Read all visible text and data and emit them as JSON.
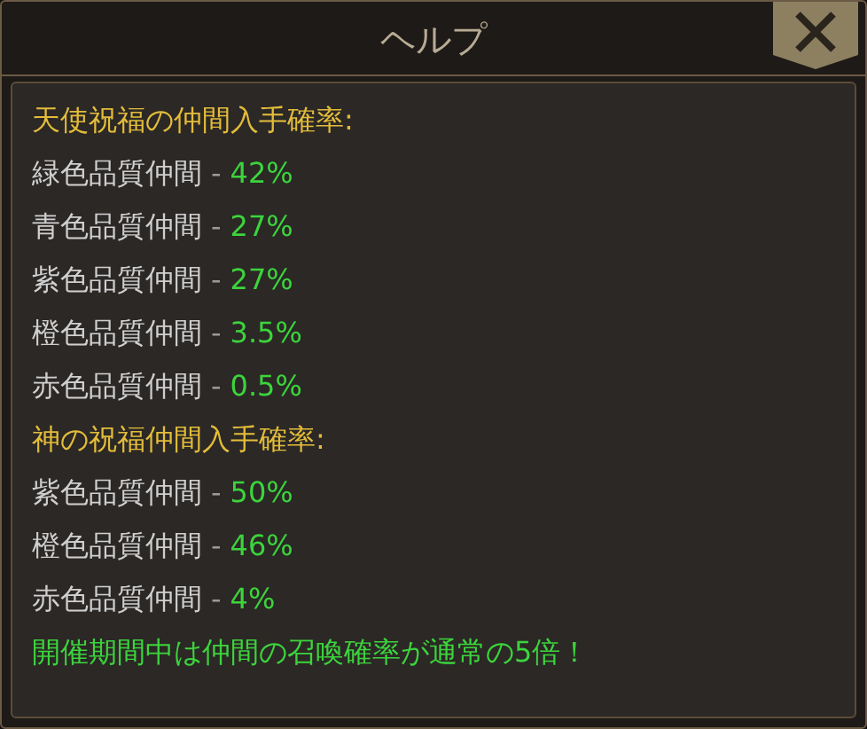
{
  "window": {
    "title": "ヘルプ"
  },
  "lines": [
    {
      "kind": "heading",
      "text": "天使祝福の仲間入手確率:"
    },
    {
      "kind": "rate",
      "label": "緑色品質仲間",
      "separator": "-",
      "value": "42%"
    },
    {
      "kind": "rate",
      "label": "青色品質仲間",
      "separator": "-",
      "value": "27%"
    },
    {
      "kind": "rate",
      "label": "紫色品質仲間",
      "separator": "-",
      "value": "27%"
    },
    {
      "kind": "rate",
      "label": "橙色品質仲間",
      "separator": "-",
      "value": "3.5%"
    },
    {
      "kind": "rate",
      "label": "赤色品質仲間",
      "separator": "-",
      "value": "0.5%"
    },
    {
      "kind": "heading",
      "text": "神の祝福仲間入手確率:"
    },
    {
      "kind": "rate",
      "label": "紫色品質仲間",
      "separator": "-",
      "value": "50%"
    },
    {
      "kind": "rate",
      "label": "橙色品質仲間",
      "separator": "-",
      "value": "46%"
    },
    {
      "kind": "rate",
      "label": "赤色品質仲間",
      "separator": "-",
      "value": "4%"
    },
    {
      "kind": "note",
      "text": "開催期間中は仲間の召喚確率が通常の5倍！"
    }
  ]
}
